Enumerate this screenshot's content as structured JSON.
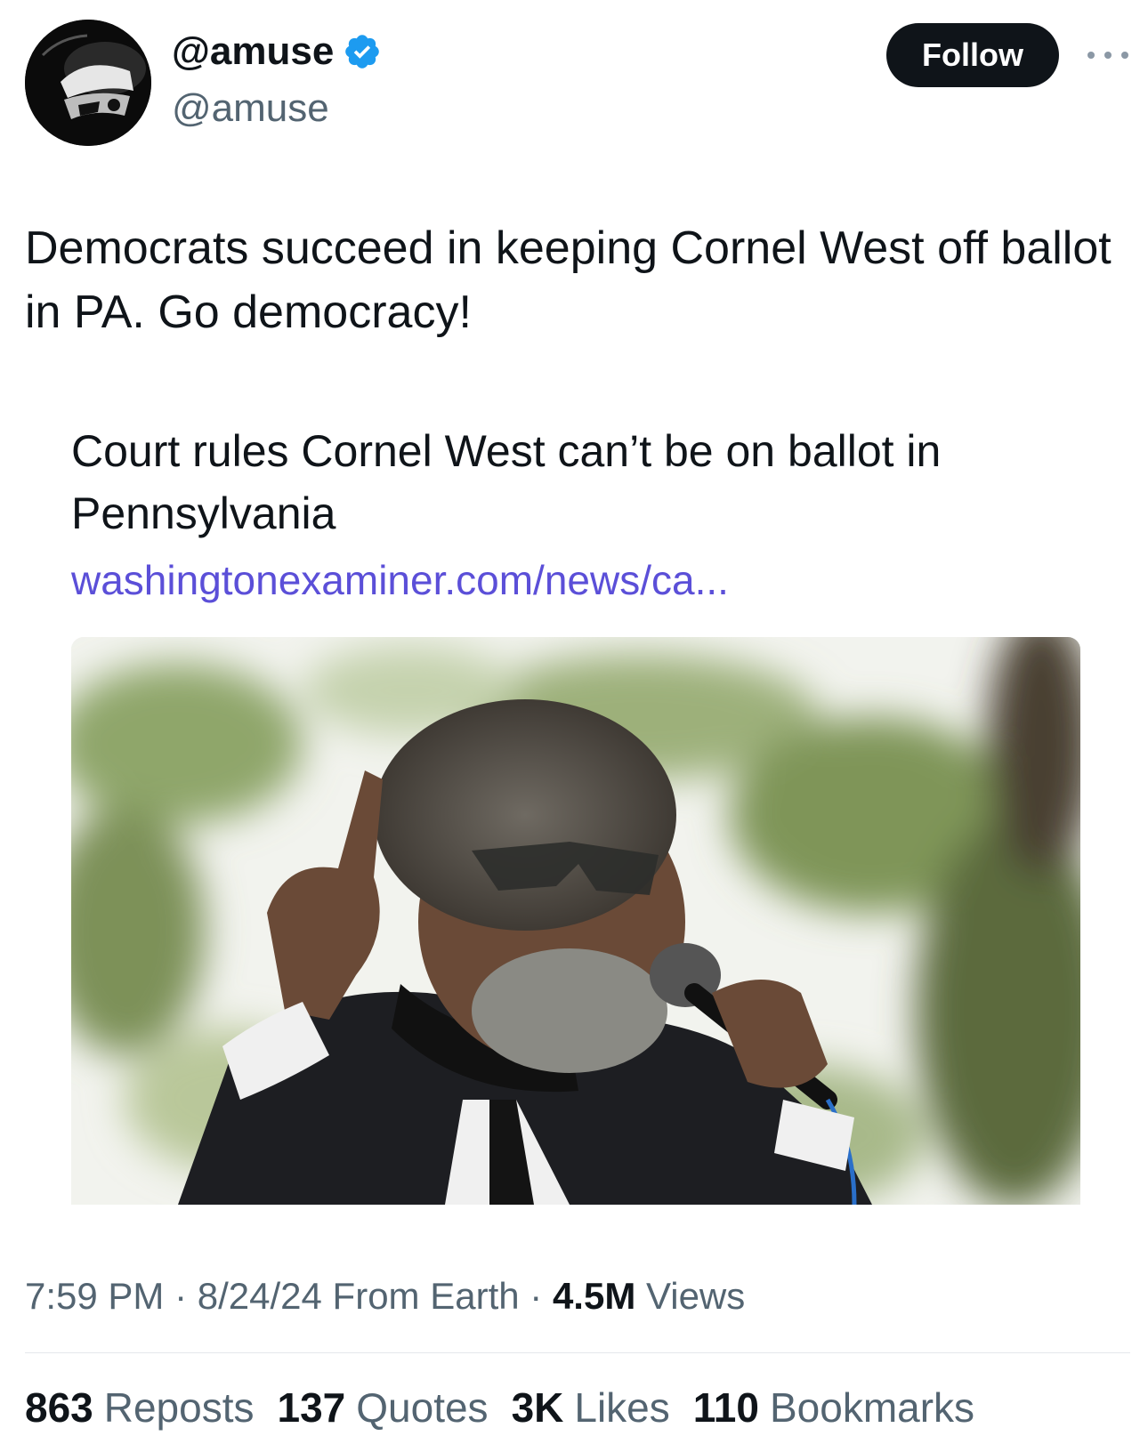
{
  "user": {
    "display_name": "@amuse",
    "handle": "@amuse",
    "verified_icon": "verified-badge-icon",
    "avatar": "stormtrooper-avatar"
  },
  "actions": {
    "follow_label": "Follow",
    "more_icon": "more-options-icon"
  },
  "tweet": {
    "text": "Democrats succeed in keeping Cornel West off ballot in PA. Go democracy!"
  },
  "card": {
    "title": "Court rules Cornel West can’t be on ballot in Pennsylvania",
    "link": "washingtonexaminer.com/news/ca..."
  },
  "meta": {
    "time": "7:59 PM",
    "sep1": " · ",
    "date": "8/24/24",
    "source": " From Earth",
    "sep2": " · ",
    "views_count": "4.5M",
    "views_label": " Views"
  },
  "stats": [
    {
      "count": "863",
      "label": "Reposts"
    },
    {
      "count": "137",
      "label": "Quotes"
    },
    {
      "count": "3K",
      "label": "Likes"
    },
    {
      "count": "110",
      "label": "Bookmarks"
    }
  ],
  "colors": {
    "text": "#0f1419",
    "secondary": "#536471",
    "link": "#5b4fd8",
    "verified": "#1d9bf0",
    "follow_bg": "#0f1419"
  }
}
